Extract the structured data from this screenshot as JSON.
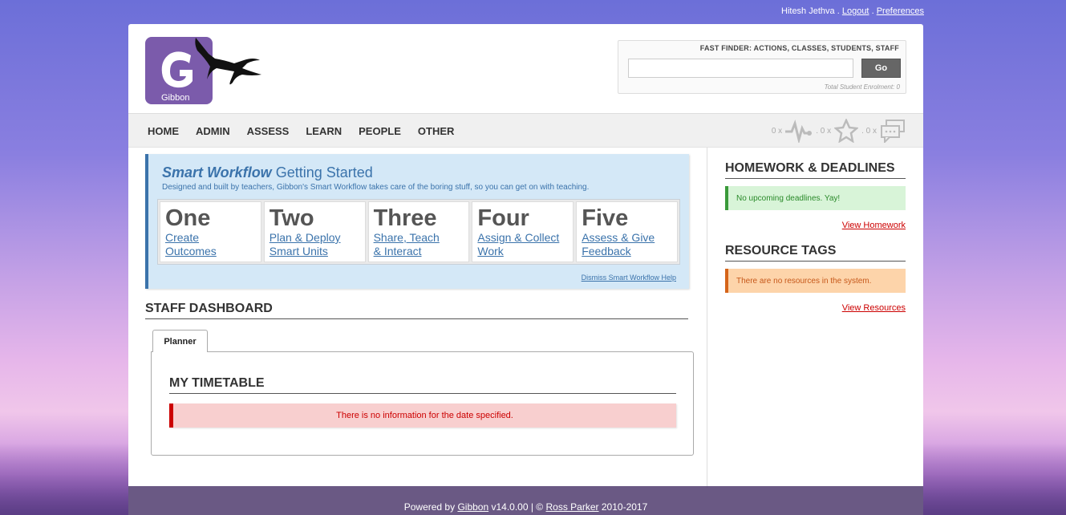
{
  "top_links": {
    "user_name": "Hitesh Jethva",
    "sep1": ".",
    "logout": "Logout",
    "sep2": ".",
    "preferences": "Preferences"
  },
  "logo": {
    "text": "Gibbon",
    "letter": "G",
    "color": "#7b5bab"
  },
  "fast_finder": {
    "title": "FAST FINDER: ACTIONS, CLASSES, STUDENTS, STAFF",
    "value": "",
    "go_label": "Go",
    "enrolment": "Total Student Enrolment: 0"
  },
  "nav": {
    "items": [
      "HOME",
      "ADMIN",
      "ASSESS",
      "LEARN",
      "PEOPLE",
      "OTHER"
    ]
  },
  "notifications": {
    "alarms_count": "0 x",
    "likes_count": ". 0 x",
    "messages_count": ". 0 x"
  },
  "workflow": {
    "title_bold": "Smart Workflow",
    "title_rest": "Getting Started",
    "subtitle": "Designed and built by teachers, Gibbon's Smart Workflow takes care of the boring stuff, so you can get on with teaching.",
    "steps": [
      {
        "num": "One",
        "line1": "Create",
        "line2": "Outcomes"
      },
      {
        "num": "Two",
        "line1": "Plan & Deploy",
        "line2": "Smart Units"
      },
      {
        "num": "Three",
        "line1": "Share, Teach",
        "line2": "& Interact"
      },
      {
        "num": "Four",
        "line1": "Assign & Collect",
        "line2": "Work"
      },
      {
        "num": "Five",
        "line1": "Assess & Give",
        "line2": "Feedback"
      }
    ],
    "dismiss": "Dismiss Smart Workflow Help"
  },
  "staff_dashboard": {
    "title": "STAFF DASHBOARD",
    "tab_label": "Planner",
    "timetable_title": "MY TIMETABLE",
    "error": "There is no information for the date specified."
  },
  "sidebar": {
    "homework_title": "HOMEWORK & DEADLINES",
    "homework_msg": "No upcoming deadlines. Yay!",
    "homework_link": "View Homework",
    "tags_title": "RESOURCE TAGS",
    "tags_msg": "There are no resources in the system.",
    "tags_link": "View Resources"
  },
  "footer": {
    "prefix": "Powered by",
    "gibbon_link": "Gibbon",
    "version": "v14.0.00 | ©",
    "author_link": "Ross Parker",
    "years": "2010-2017"
  }
}
